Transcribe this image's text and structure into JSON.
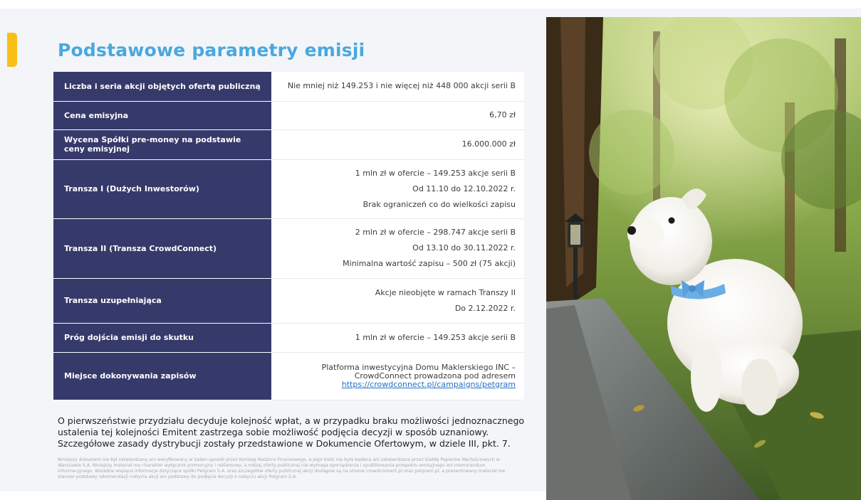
{
  "title": "Podstawowe parametry emisji",
  "table": {
    "rows": [
      {
        "label": "Liczba i seria akcji objętych ofertą publiczną",
        "lines": [
          "Nie mniej niż 149.253 i nie więcej niż 448 000 akcji serii B"
        ]
      },
      {
        "label": "Cena emisyjna",
        "lines": [
          "6,70 zł"
        ]
      },
      {
        "label": "Wycena Spółki pre-money  na podstawie ceny emisyjnej",
        "lines": [
          "16.000.000 zł"
        ]
      },
      {
        "label": "Transza I (Dużych Inwestorów)",
        "lines": [
          "1 mln zł w ofercie – 149.253 akcje serii B",
          "Od 11.10 do 12.10.2022 r.",
          "Brak ograniczeń co do wielkości zapisu"
        ]
      },
      {
        "label": "Transza II (Transza CrowdConnect)",
        "lines": [
          "2 mln zł w ofercie – 298.747 akcje serii B",
          "Od 13.10 do 30.11.2022 r.",
          "Minimalna wartość zapisu – 500 zł (75 akcji)"
        ]
      },
      {
        "label": "Transza uzupełniająca",
        "lines": [
          "Akcje nieobjęte w ramach Transzy II",
          "Do 2.12.2022 r."
        ]
      },
      {
        "label": "Próg dojścia emisji do skutku",
        "lines": [
          "1 mln zł w ofercie – 149.253 akcje serii B"
        ]
      },
      {
        "label": "Miejsce dokonywania zapisów",
        "lines": [
          "Platforma inwestycyjna Domu Maklerskiego INC –",
          "CrowdConnect prowadzona pod adresem"
        ],
        "link": "https://crowdconnect.pl/campaigns/petgram"
      }
    ]
  },
  "note": "O pierwszeństwie przydziału decyduje kolejność wpłat, a w przypadku braku możliwości jednoznacznego ustalenia tej kolejności Emitent zastrzega sobie możliwość podjęcia decyzji w sposób uznaniowy. Szczegółowe zasady dystrybucji zostały przedstawione w Dokumencie Ofertowym, w dziele III, pkt. 7.",
  "disclaimer": "Niniejszy dokument nie był zatwierdzany ani weryfikowany w żaden sposób przez Komisję Nadzoru Finansowego, a jego treść nie była badana ani zatwierdzana przez Giełdę Papierów Wartościowych w Warszawie S.A. Niniejszy materiał ma charakter wyłącznie promocyjny i reklamowy, a rodzaj oferty publicznej nie wymaga sporządzenia i opublikowania prospektu emisyjnego ani memorandum informacyjnego. Wszelkie wiążące informacje dotyczące spółki Petgram S.A. oraz szczegółów oferty publicznej akcji dostępne są na stronie crowdconnect.pl oraz petgram.pl, a prezentowany materiał nie stanowi podstawy rekomendacji nabycia akcji ani podstawy do podjęcia decyzji o nabyciu akcji Petgram S.A.",
  "colors": {
    "accent": "#f7bf16",
    "title": "#4aa8dd",
    "label_bg": "#363a6a",
    "link": "#2470c8"
  }
}
